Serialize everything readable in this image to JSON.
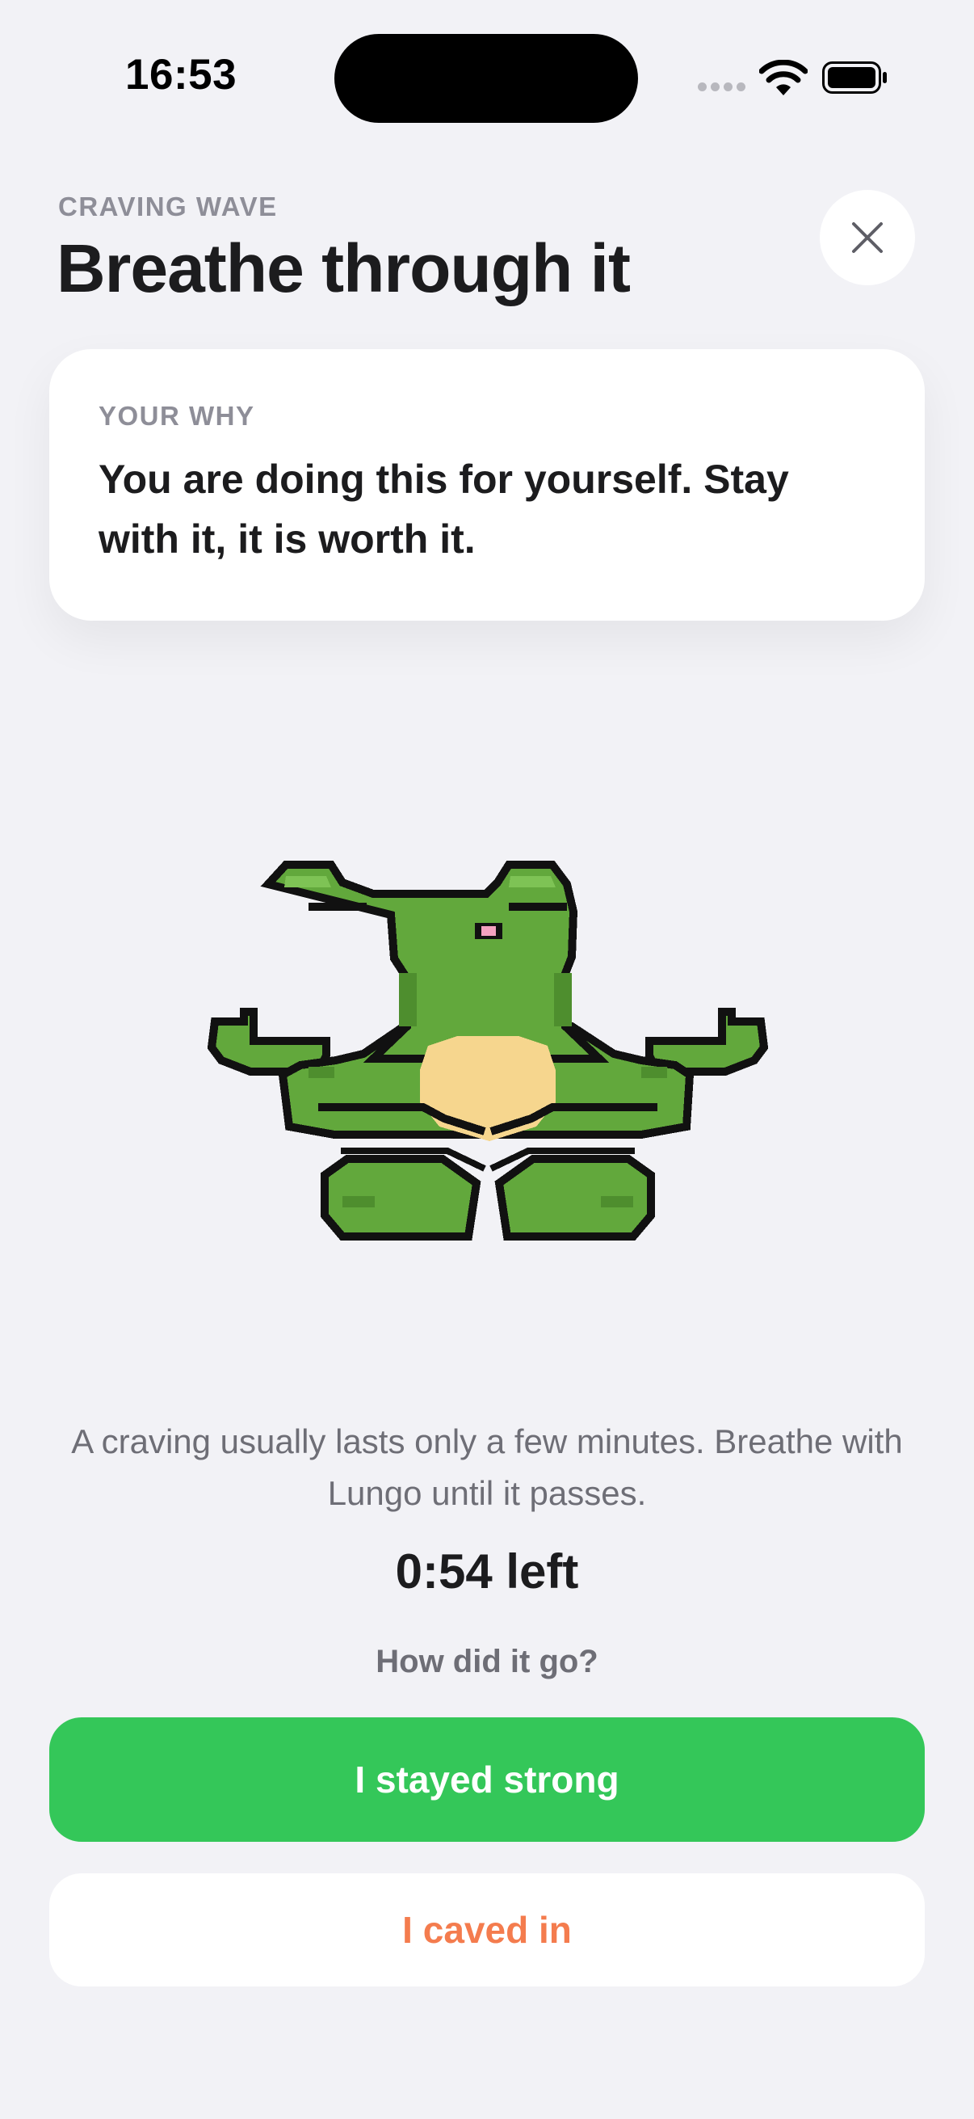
{
  "status_bar": {
    "time": "16:53",
    "icons": [
      "signal-icon",
      "wifi-icon",
      "battery-icon"
    ]
  },
  "header": {
    "eyebrow": "CRAVING WAVE",
    "title": "Breathe through it",
    "close_icon": "close-icon"
  },
  "why_card": {
    "label": "YOUR WHY",
    "text": "You are doing this for yourself. Stay with it, it is worth it."
  },
  "mascot": {
    "icon": "meditating-frog-icon"
  },
  "session": {
    "info": "A craving usually lasts only a few minutes. Breathe with Lungo until it passes.",
    "timer": "0:54 left",
    "prompt": "How did it go?"
  },
  "actions": {
    "strong_label": "I stayed strong",
    "caved_label": "I caved in"
  },
  "colors": {
    "background": "#F2F2F6",
    "primary_green": "#34C759",
    "caved_orange": "#F47C4E",
    "frog_green": "#62A83C",
    "frog_belly": "#F6D68E"
  }
}
